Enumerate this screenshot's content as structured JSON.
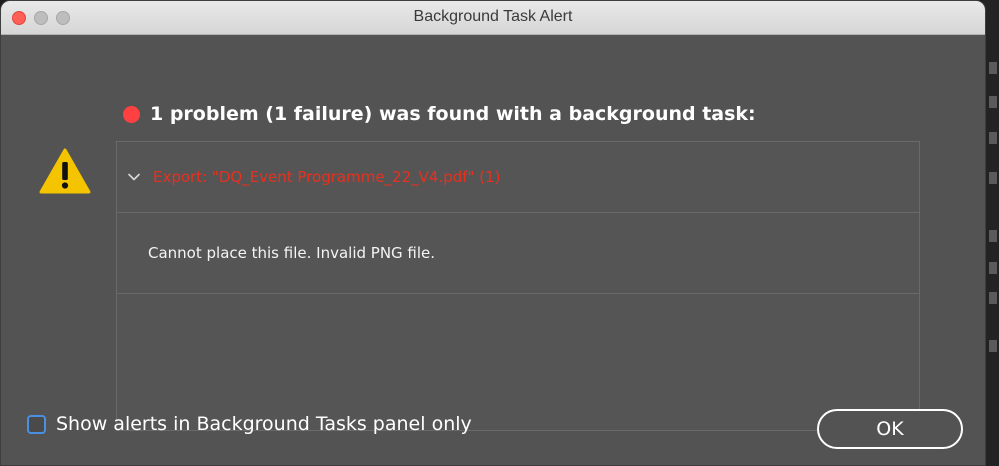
{
  "window": {
    "title": "Background Task Alert"
  },
  "alert": {
    "headline": "1 problem (1 failure) was found with a background task:",
    "task_name": "Export: \"DQ_Event Programme_22_V4.pdf\" (1)",
    "message": "Cannot place this file. Invalid PNG file."
  },
  "footer": {
    "checkbox_label": "Show alerts in Background Tasks panel only",
    "checkbox_checked": false,
    "ok_label": "OK"
  },
  "icons": {
    "warning": "warning-triangle-icon",
    "error_dot": "error-dot-icon",
    "expand": "chevron-down-icon"
  },
  "colors": {
    "dialog_bg": "#535353",
    "error_red": "#e8301f",
    "warning_yellow": "#f5c400",
    "checkbox_blue": "#4a90e2"
  }
}
